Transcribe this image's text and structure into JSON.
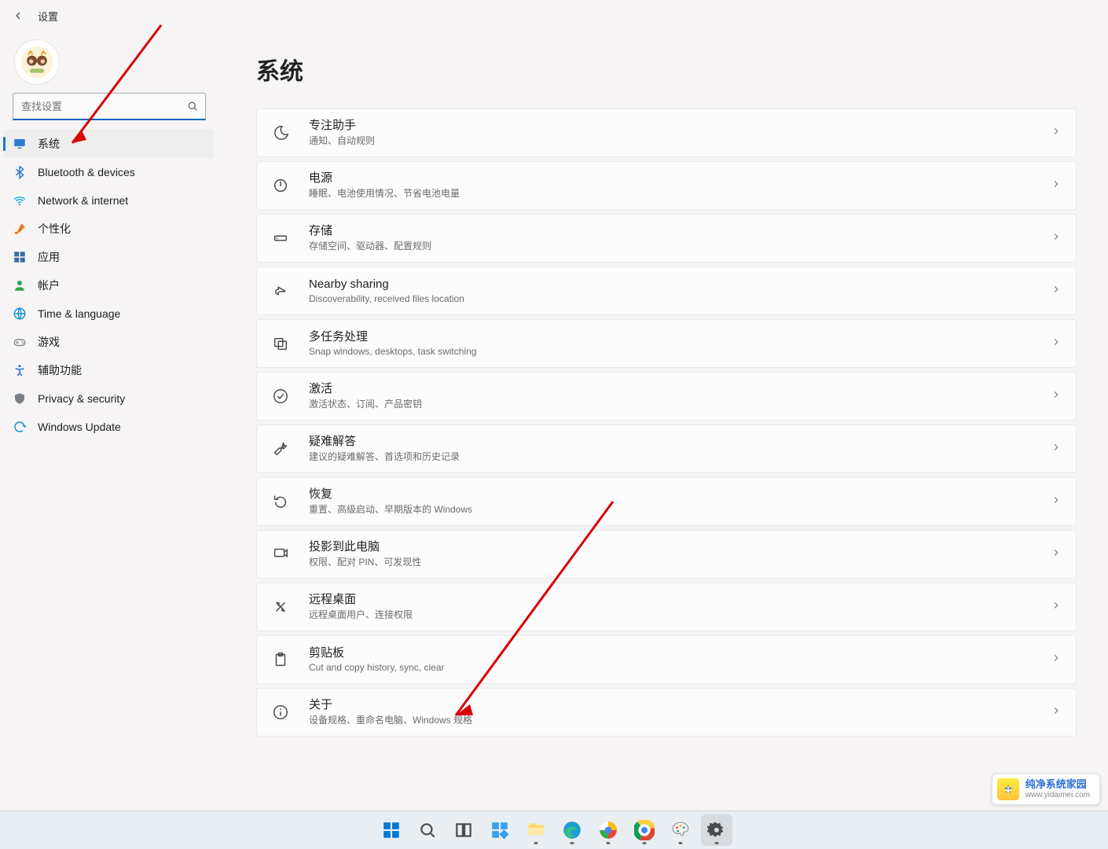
{
  "titlebar": {
    "title": "设置"
  },
  "search": {
    "placeholder": "查找设置"
  },
  "sidebar": {
    "items": [
      {
        "key": "system",
        "label": "系统",
        "icon": "monitor",
        "color": "#2b7cd3",
        "selected": true
      },
      {
        "key": "bluetooth",
        "label": "Bluetooth & devices",
        "icon": "bluetooth",
        "color": "#2f7bd0"
      },
      {
        "key": "network",
        "label": "Network & internet",
        "icon": "wifi",
        "color": "#19b3e6"
      },
      {
        "key": "personalize",
        "label": "个性化",
        "icon": "brush",
        "color": "#e87a1f"
      },
      {
        "key": "apps",
        "label": "应用",
        "icon": "grid",
        "color": "#3a6ea5"
      },
      {
        "key": "accounts",
        "label": "帐户",
        "icon": "person",
        "color": "#2da44e"
      },
      {
        "key": "timelang",
        "label": "Time & language",
        "icon": "globe",
        "color": "#1993d0"
      },
      {
        "key": "gaming",
        "label": "游戏",
        "icon": "gamepad",
        "color": "#8a8f96"
      },
      {
        "key": "accessibility",
        "label": "辅助功能",
        "icon": "access",
        "color": "#1f6fd0"
      },
      {
        "key": "privacy",
        "label": "Privacy & security",
        "icon": "shield",
        "color": "#7a8088"
      },
      {
        "key": "update",
        "label": "Windows Update",
        "icon": "sync",
        "color": "#0e8fd6"
      }
    ]
  },
  "page": {
    "heading": "系统"
  },
  "cards": [
    {
      "key": "focus",
      "icon": "moon",
      "title": "专注助手",
      "sub": "通知、自动规则"
    },
    {
      "key": "power",
      "icon": "power",
      "title": "电源",
      "sub": "睡眠、电池使用情况、节省电池电量"
    },
    {
      "key": "storage",
      "icon": "storage",
      "title": "存储",
      "sub": "存储空间、驱动器、配置规则"
    },
    {
      "key": "nearby",
      "icon": "share",
      "title": "Nearby sharing",
      "sub": "Discoverability, received files location"
    },
    {
      "key": "multitask",
      "icon": "multitask",
      "title": "多任务处理",
      "sub": "Snap windows, desktops, task switching"
    },
    {
      "key": "activation",
      "icon": "check",
      "title": "激活",
      "sub": "激活状态、订阅、产品密钥"
    },
    {
      "key": "troubleshoot",
      "icon": "wrench",
      "title": "疑难解答",
      "sub": "建议的疑难解答、首选项和历史记录"
    },
    {
      "key": "recovery",
      "icon": "recovery",
      "title": "恢复",
      "sub": "重置、高级启动、早期版本的 Windows"
    },
    {
      "key": "project",
      "icon": "project",
      "title": "投影到此电脑",
      "sub": "权限、配对 PIN、可发现性"
    },
    {
      "key": "remote",
      "icon": "remote",
      "title": "远程桌面",
      "sub": "远程桌面用户、连接权限"
    },
    {
      "key": "clipboard",
      "icon": "clipboard",
      "title": "剪贴板",
      "sub": "Cut and copy history, sync, clear"
    },
    {
      "key": "about",
      "icon": "info",
      "title": "关于",
      "sub": "设备规格、重命名电脑、Windows 规格"
    }
  ],
  "watermark": {
    "name": "纯净系统家园",
    "url": "www.yidaimei.com"
  },
  "taskbar": {
    "items": [
      {
        "key": "start",
        "icon": "winlogo"
      },
      {
        "key": "search",
        "icon": "search"
      },
      {
        "key": "taskview",
        "icon": "taskview"
      },
      {
        "key": "widgets",
        "icon": "widgets"
      },
      {
        "key": "explorer",
        "icon": "folder",
        "running": true
      },
      {
        "key": "edge",
        "icon": "edge",
        "running": true
      },
      {
        "key": "app1",
        "icon": "circle-color",
        "running": true
      },
      {
        "key": "chrome",
        "icon": "chrome",
        "running": true
      },
      {
        "key": "paint",
        "icon": "paint",
        "running": true
      },
      {
        "key": "settings",
        "icon": "gear",
        "running": true,
        "active": true
      }
    ]
  }
}
